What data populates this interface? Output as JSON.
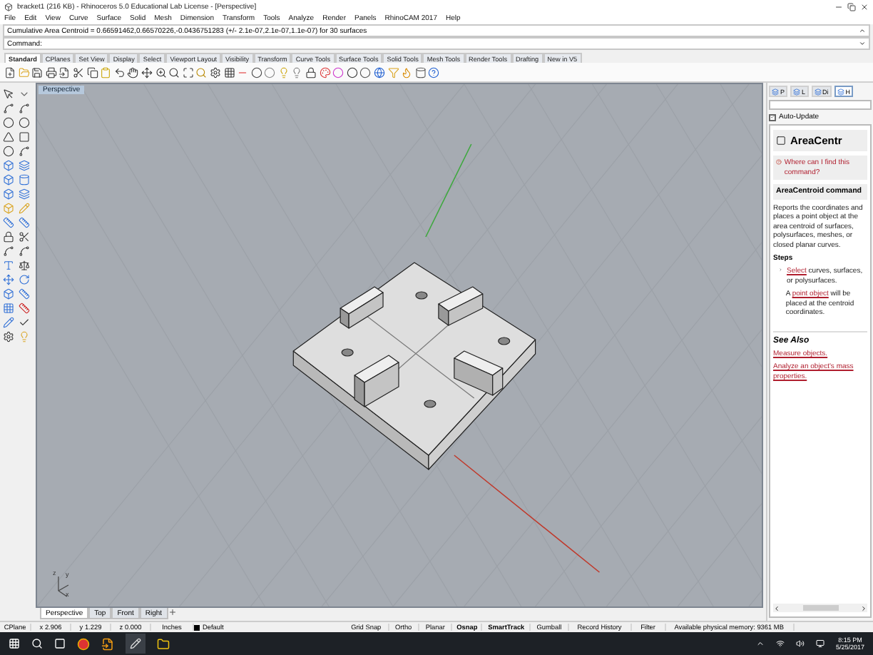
{
  "window": {
    "title": "bracket1 (216 KB) - Rhinoceros 5.0 Educational Lab License - [Perspective]"
  },
  "menu": [
    "File",
    "Edit",
    "View",
    "Curve",
    "Surface",
    "Solid",
    "Mesh",
    "Dimension",
    "Transform",
    "Tools",
    "Analyze",
    "Render",
    "Panels",
    "RhinoCAM 2017",
    "Help"
  ],
  "command_history": "Cumulative Area Centroid = 0.66591462,0.66570226,-0.0436751283 (+/- 2.1e-07,2.1e-07,1.1e-07) for 30 surfaces",
  "command_prompt": "Command:",
  "toolbar_tabs": [
    {
      "label": "Standard",
      "selected": true
    },
    {
      "label": "CPlanes",
      "selected": false
    },
    {
      "label": "Set View",
      "selected": false
    },
    {
      "label": "Display",
      "selected": false
    },
    {
      "label": "Select",
      "selected": false
    },
    {
      "label": "Viewport Layout",
      "selected": false
    },
    {
      "label": "Visibility",
      "selected": false
    },
    {
      "label": "Transform",
      "selected": false
    },
    {
      "label": "Curve Tools",
      "selected": false
    },
    {
      "label": "Surface Tools",
      "selected": false
    },
    {
      "label": "Solid Tools",
      "selected": false
    },
    {
      "label": "Mesh Tools",
      "selected": false
    },
    {
      "label": "Render Tools",
      "selected": false
    },
    {
      "label": "Drafting",
      "selected": false
    },
    {
      "label": "New in V5",
      "selected": false
    }
  ],
  "viewport": {
    "title": "Perspective",
    "axis_labels": [
      "z",
      "y",
      "x"
    ]
  },
  "viewport_tabs": [
    {
      "label": "Perspective",
      "selected": true
    },
    {
      "label": "Top",
      "selected": false
    },
    {
      "label": "Front",
      "selected": false
    },
    {
      "label": "Right",
      "selected": false
    }
  ],
  "panel": {
    "tabs": [
      {
        "label": "P",
        "selected": false
      },
      {
        "label": "L",
        "selected": false
      },
      {
        "label": "Di",
        "selected": false
      },
      {
        "label": "H",
        "selected": true
      }
    ],
    "auto_update": {
      "label": "Auto-Update",
      "checked": true
    },
    "help": {
      "title": "AreaCentr",
      "where_link": "Where can I find this command?",
      "heading": "AreaCentroid command",
      "description": "Reports the coordinates and places a point object at the area centroid of surfaces, polysurfaces, meshes, or closed planar curves.",
      "steps_label": "Steps",
      "steps": [
        [
          {
            "text": "Select",
            "link": true
          },
          {
            "text": " curves, surfaces, or polysurfaces.",
            "link": false
          }
        ],
        [
          {
            "text": "A ",
            "link": false
          },
          {
            "text": "point object",
            "link": true
          },
          {
            "text": " will be placed at the centroid coordinates.",
            "link": false
          }
        ]
      ],
      "see_also_label": "See Also",
      "see_also": [
        "Measure objects.",
        "Analyze an object's mass properties."
      ]
    }
  },
  "status_bar": {
    "cplane": "CPlane",
    "x": "x 2.906",
    "y": "y 1.229",
    "z": "z 0.000",
    "units": "Inches",
    "layer": {
      "label": "Default",
      "color": "#000000"
    },
    "toggles": [
      {
        "label": "Grid Snap",
        "on": false
      },
      {
        "label": "Ortho",
        "on": false
      },
      {
        "label": "Planar",
        "on": false
      },
      {
        "label": "Osnap",
        "on": true
      },
      {
        "label": "SmartTrack",
        "on": true
      },
      {
        "label": "Gumball",
        "on": false
      },
      {
        "label": "Record History",
        "on": false
      },
      {
        "label": "Filter",
        "on": false
      }
    ],
    "memory": "Available physical memory: 9361 MB"
  },
  "taskbar": {
    "time": "8:15 PM",
    "date": "5/25/2017"
  }
}
